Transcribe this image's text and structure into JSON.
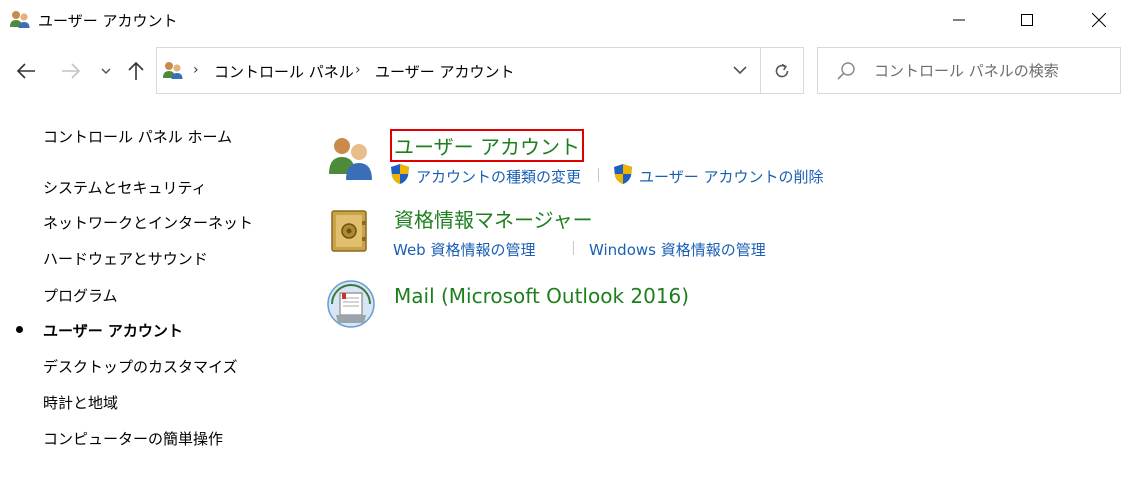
{
  "window": {
    "title": "ユーザー アカウント",
    "icon": "user-accounts-icon",
    "controls": [
      "minimize-icon",
      "maximize-icon",
      "close-icon"
    ]
  },
  "nav": {
    "back_icon": "arrow-left-icon",
    "forward_icon": "arrow-right-icon",
    "recent_icon": "chevron-down-icon",
    "up_icon": "arrow-up-icon"
  },
  "address": {
    "icon": "user-accounts-icon",
    "breadcrumbs": [
      "コントロール パネル",
      "ユーザー アカウント"
    ],
    "separator": "›",
    "dropdown_icon": "chevron-down-icon",
    "refresh_icon": "refresh-icon"
  },
  "search": {
    "placeholder": "コントロール パネルの検索",
    "value": "",
    "icon": "search-icon"
  },
  "sidebar": {
    "items": [
      {
        "label": "コントロール パネル ホーム",
        "active": false
      },
      {
        "label": "システムとセキュリティ",
        "active": false
      },
      {
        "label": "ネットワークとインターネット",
        "active": false
      },
      {
        "label": "ハードウェアとサウンド",
        "active": false
      },
      {
        "label": "プログラム",
        "active": false
      },
      {
        "label": "ユーザー アカウント",
        "active": true
      },
      {
        "label": "デスクトップのカスタマイズ",
        "active": false
      },
      {
        "label": "時計と地域",
        "active": false
      },
      {
        "label": "コンピューターの簡単操作",
        "active": false
      }
    ]
  },
  "categories": [
    {
      "title": "ユーザー アカウント",
      "icon": "user-accounts-icon",
      "highlighted": true,
      "tasks": [
        {
          "label": "アカウントの種類の変更",
          "icon": "uac-shield-icon"
        },
        {
          "label": "ユーザー アカウントの削除",
          "icon": "uac-shield-icon"
        }
      ]
    },
    {
      "title": "資格情報マネージャー",
      "icon": "credential-vault-icon",
      "highlighted": false,
      "tasks": [
        {
          "label": "Web 資格情報の管理"
        },
        {
          "label": "Windows 資格情報の管理"
        }
      ]
    },
    {
      "title": "Mail (Microsoft Outlook 2016)",
      "icon": "mail-icon",
      "highlighted": false,
      "tasks": []
    }
  ],
  "colors": {
    "category_title": "#1e7f1e",
    "task_link": "#1a5fb4",
    "highlight_border": "#e00000"
  }
}
